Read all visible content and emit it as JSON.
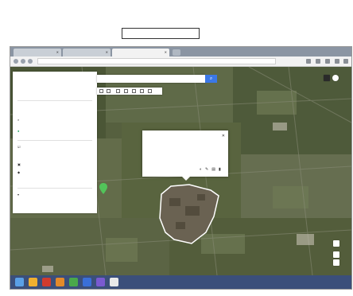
{
  "header": {
    "line1": "",
    "line1_right": "",
    "line2_left": "",
    "line2_mid": "",
    "action_label": ""
  },
  "browser": {
    "tabs": [
      {
        "label": ""
      },
      {
        "label": ""
      },
      {
        "label": ""
      }
    ],
    "url": ""
  },
  "map": {
    "search": {
      "placeholder": ""
    },
    "panel": {
      "title": "",
      "subtitle": "",
      "small": "",
      "actions": [
        "",
        "",
        ""
      ],
      "add_layer": "",
      "layer_item": "",
      "layer_name": "",
      "layer_sub": "",
      "style_item": "",
      "selected_item": "",
      "base_map": ""
    },
    "popup": {
      "title": "",
      "line": "",
      "footer": ""
    },
    "bottom_bar": ""
  },
  "taskbar": {
    "icons": [
      {
        "name": "start-icon",
        "color": "#5aa0e6"
      },
      {
        "name": "explorer-icon",
        "color": "#f0b030"
      },
      {
        "name": "app-icon-red",
        "color": "#d13b2e"
      },
      {
        "name": "app-icon-orange",
        "color": "#e48a2a"
      },
      {
        "name": "app-icon-green",
        "color": "#4aa84a"
      },
      {
        "name": "app-icon-blue",
        "color": "#3a6fd8"
      },
      {
        "name": "app-icon-purple",
        "color": "#7a5ad0"
      },
      {
        "name": "browser-icon",
        "color": "#e9e9e9"
      }
    ],
    "clock": ""
  },
  "colors": {
    "accent": "#3b78e7",
    "taskbar": "#3b4f7a",
    "tabstrip": "#8b95a3"
  }
}
